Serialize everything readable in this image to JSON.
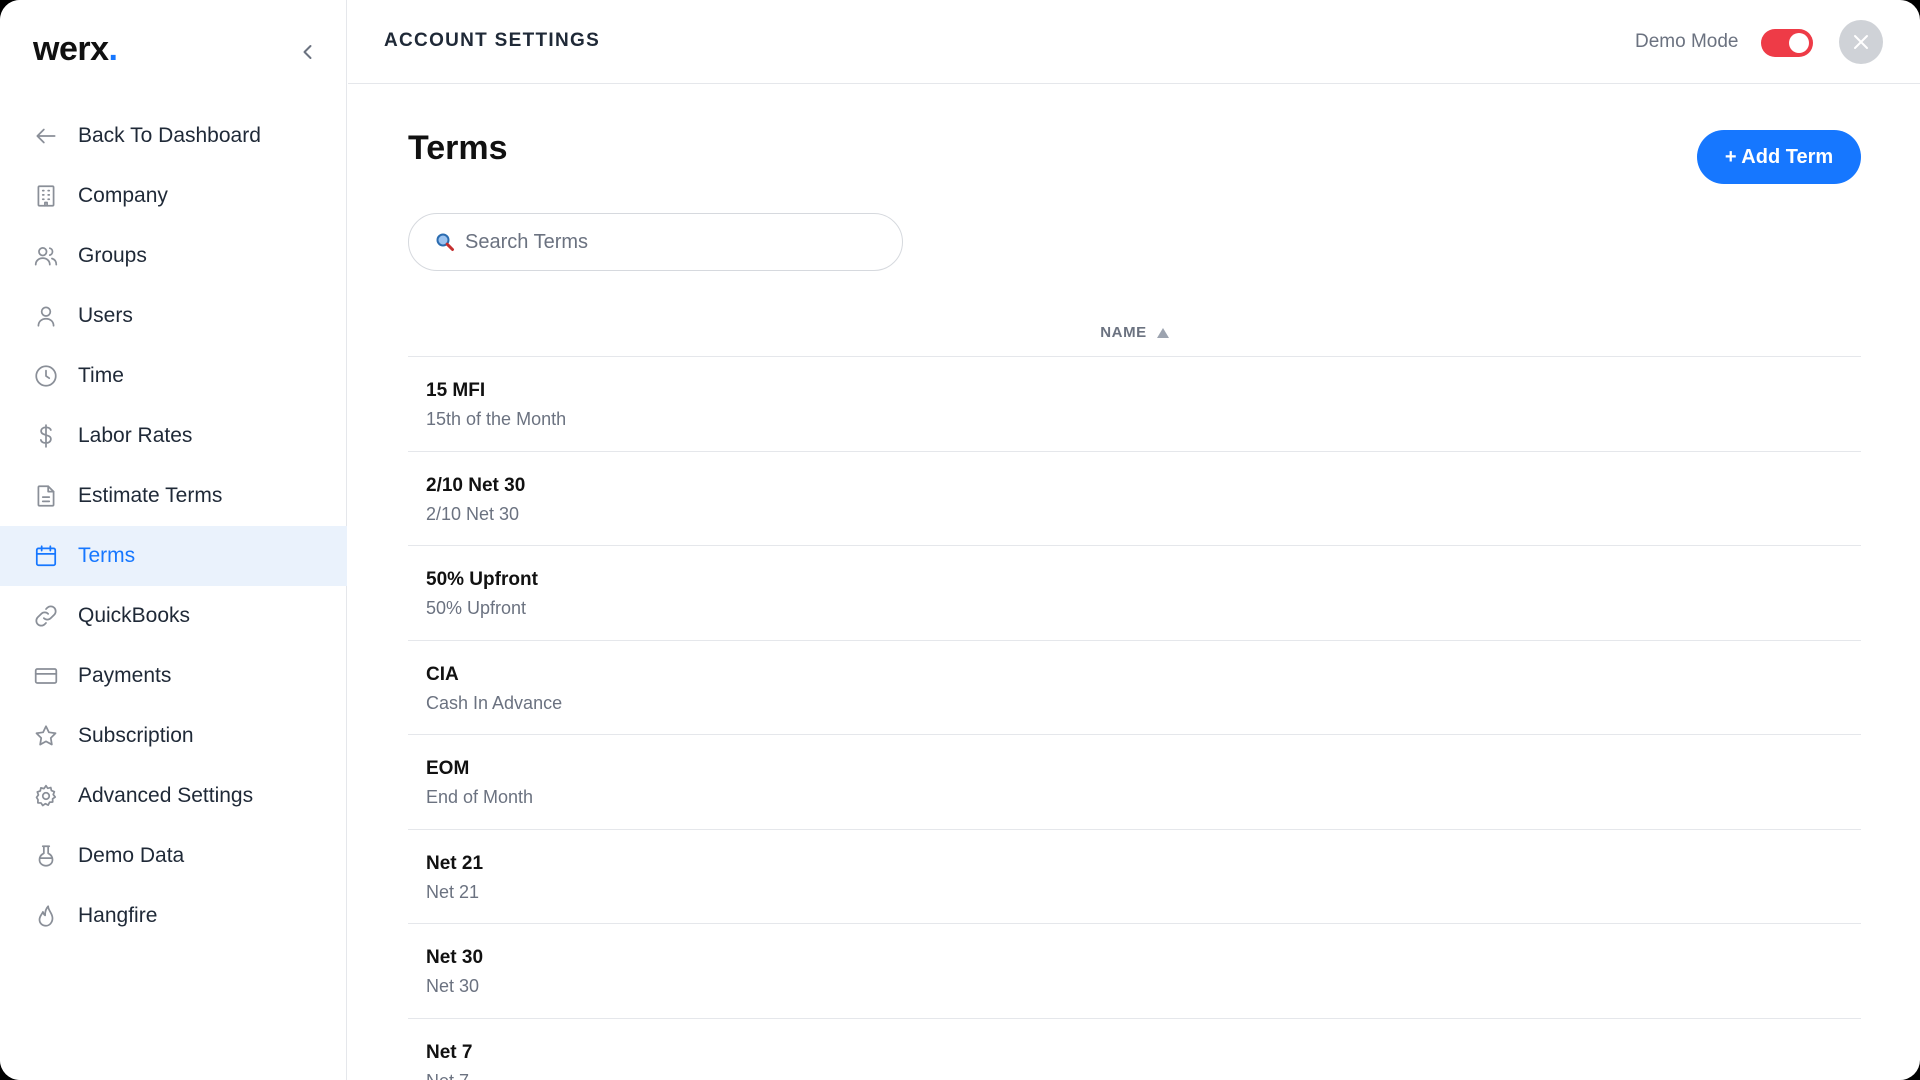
{
  "brand": {
    "name": "werx",
    "dot": "."
  },
  "header": {
    "title": "ACCOUNT SETTINGS",
    "demo_mode_label": "Demo Mode",
    "demo_mode_on": true
  },
  "sidebar": {
    "items": [
      {
        "label": "Back To Dashboard",
        "icon": "arrow-left-icon"
      },
      {
        "label": "Company",
        "icon": "building-icon"
      },
      {
        "label": "Groups",
        "icon": "users-group-icon"
      },
      {
        "label": "Users",
        "icon": "user-icon"
      },
      {
        "label": "Time",
        "icon": "clock-icon"
      },
      {
        "label": "Labor Rates",
        "icon": "dollar-icon"
      },
      {
        "label": "Estimate Terms",
        "icon": "document-icon"
      },
      {
        "label": "Terms",
        "icon": "calendar-icon",
        "active": true
      },
      {
        "label": "QuickBooks",
        "icon": "link-icon"
      },
      {
        "label": "Payments",
        "icon": "credit-card-icon"
      },
      {
        "label": "Subscription",
        "icon": "star-icon"
      },
      {
        "label": "Advanced Settings",
        "icon": "gear-icon"
      },
      {
        "label": "Demo Data",
        "icon": "flask-icon"
      },
      {
        "label": "Hangfire",
        "icon": "flame-icon"
      }
    ]
  },
  "main": {
    "title": "Terms",
    "add_button": "+ Add Term",
    "search": {
      "placeholder": "Search Terms",
      "value": ""
    },
    "table": {
      "column": "NAME",
      "rows": [
        {
          "name": "15 MFI",
          "description": "15th of the Month"
        },
        {
          "name": "2/10 Net 30",
          "description": "2/10 Net 30"
        },
        {
          "name": "50% Upfront",
          "description": "50% Upfront"
        },
        {
          "name": "CIA",
          "description": "Cash In Advance"
        },
        {
          "name": "EOM",
          "description": "End of Month"
        },
        {
          "name": "Net 21",
          "description": "Net 21"
        },
        {
          "name": "Net 30",
          "description": "Net 30"
        },
        {
          "name": "Net 7",
          "description": "Net 7"
        }
      ]
    }
  },
  "colors": {
    "accent": "#1677ff",
    "toggle_on": "#ee3b47",
    "active_bg": "#eaf2fc"
  }
}
